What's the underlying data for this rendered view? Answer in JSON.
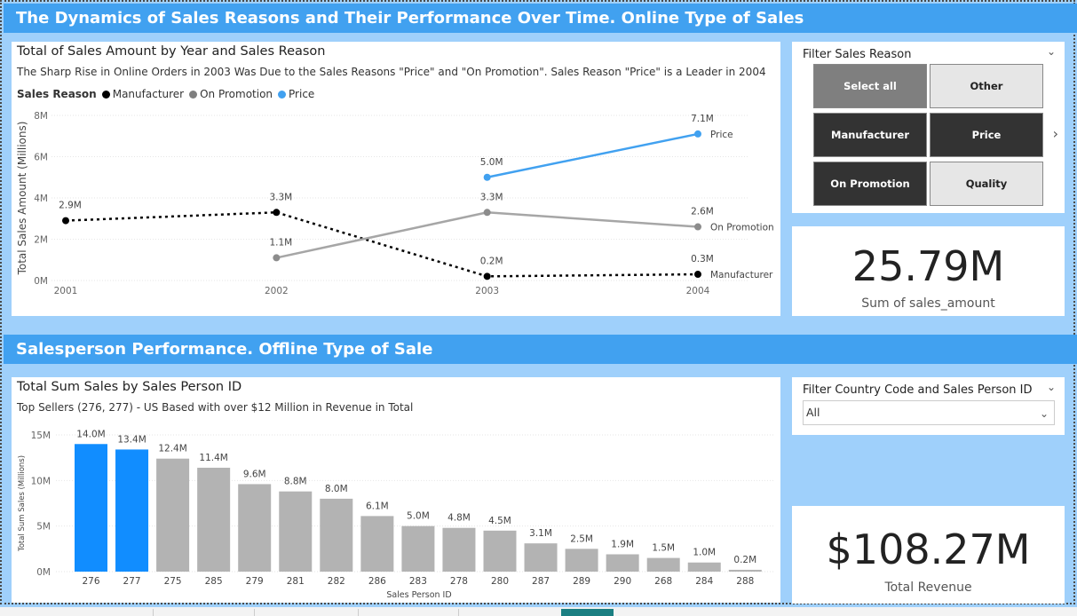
{
  "banner_top": "The Dynamics of Sales Reasons and Their Performance Over Time. Online Type of Sales",
  "banner_bottom": "Salesperson Performance. Offline Type of Sale",
  "line_card": {
    "title": "Total of Sales Amount by Year and Sales Reason",
    "subtitle": "The Sharp Rise in Online Orders in 2003 Was Due to the Sales Reasons \"Price\" and \"On Promotion\". Sales Reason \"Price\" is a Leader in 2004",
    "legend_label": "Sales Reason"
  },
  "slicer_reason": {
    "title": "Filter Sales Reason",
    "tiles": [
      "Select all",
      "Other",
      "Manufacturer",
      "Price",
      "On Promotion",
      "Quality"
    ]
  },
  "kpi_sales": {
    "value": "25.79M",
    "label": "Sum of sales_amount"
  },
  "bar_card": {
    "title": "Total Sum Sales by Sales Person ID",
    "subtitle": "Top Sellers (276, 277) - US Based with over $12 Million in Revenue in Total"
  },
  "slicer_country": {
    "title": "Filter Country Code and Sales Person ID",
    "selected": "All"
  },
  "kpi_revenue": {
    "value": "$108.27M",
    "label": "Total Revenue"
  },
  "colors": {
    "banner": "#41a1f0",
    "price": "#41a1f0",
    "promo": "#a6a6a6",
    "manufacturer": "#000000",
    "bar_highlight": "#118dff",
    "bar_default": "#b3b3b3"
  },
  "chart_data": [
    {
      "type": "line",
      "title": "Total of Sales Amount by Year and Sales Reason",
      "xlabel": "",
      "ylabel": "Total Sales Amount (Millions)",
      "x": [
        "2001",
        "2002",
        "2003",
        "2004"
      ],
      "ylim": [
        0,
        8
      ],
      "yticks": [
        "0M",
        "2M",
        "4M",
        "6M",
        "8M"
      ],
      "series": [
        {
          "name": "Manufacturer",
          "values": [
            2.9,
            3.3,
            0.2,
            0.3
          ],
          "labels": [
            "2.9M",
            "3.3M",
            "0.2M",
            "0.3M"
          ],
          "style": "dotted"
        },
        {
          "name": "On Promotion",
          "values": [
            null,
            1.1,
            3.3,
            2.6
          ],
          "labels": [
            "",
            "1.1M",
            "3.3M",
            "2.6M"
          ]
        },
        {
          "name": "Price",
          "values": [
            null,
            null,
            5.0,
            7.1
          ],
          "labels": [
            "",
            "",
            "5.0M",
            "7.1M"
          ]
        }
      ],
      "grid": true,
      "legend": "top-left"
    },
    {
      "type": "bar",
      "title": "Total Sum Sales by Sales Person ID",
      "xlabel": "Sales Person ID",
      "ylabel": "Total Sum Sales (Millions)",
      "categories": [
        "276",
        "277",
        "275",
        "285",
        "279",
        "281",
        "282",
        "286",
        "283",
        "278",
        "280",
        "287",
        "289",
        "290",
        "268",
        "284",
        "288"
      ],
      "values": [
        14.0,
        13.4,
        12.4,
        11.4,
        9.6,
        8.8,
        8.0,
        6.1,
        5.0,
        4.8,
        4.5,
        3.1,
        2.5,
        1.9,
        1.5,
        1.0,
        0.2
      ],
      "labels": [
        "14.0M",
        "13.4M",
        "12.4M",
        "11.4M",
        "9.6M",
        "8.8M",
        "8.0M",
        "6.1M",
        "5.0M",
        "4.8M",
        "4.5M",
        "3.1M",
        "2.5M",
        "1.9M",
        "1.5M",
        "1.0M",
        "0.2M"
      ],
      "highlighted": [
        "276",
        "277"
      ],
      "ylim": [
        0,
        15
      ],
      "yticks": [
        "0M",
        "5M",
        "10M",
        "15M"
      ],
      "grid": true
    }
  ]
}
